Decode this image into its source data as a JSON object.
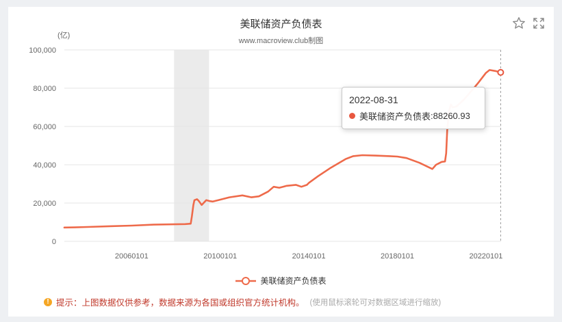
{
  "chart_data": {
    "type": "line",
    "title": "美联储资产负债表",
    "subtitle": "www.macroview.club制图",
    "ylabel": "(亿)",
    "xlabel": "",
    "ylim": [
      0,
      100000
    ],
    "yticks": [
      "0",
      "20,000",
      "40,000",
      "60,000",
      "80,000",
      "100,000"
    ],
    "xticks": [
      {
        "date": "2006-01-01",
        "label": "20060101"
      },
      {
        "date": "2010-01-01",
        "label": "20100101"
      },
      {
        "date": "2014-01-01",
        "label": "20140101"
      },
      {
        "date": "2018-01-01",
        "label": "20180101"
      },
      {
        "date": "2022-01-01",
        "label": "20220101"
      }
    ],
    "xlim": [
      "2002-12-18",
      "2022-09-07"
    ],
    "grid": true,
    "legend": "bottom-center",
    "shaded_region": {
      "start": "2007-12-01",
      "end": "2009-06-30"
    },
    "series": [
      {
        "name": "美联储资产负债表",
        "color": "#ee6a4a",
        "points": [
          [
            "2002-12-18",
            7200
          ],
          [
            "2003-06-01",
            7300
          ],
          [
            "2004-01-01",
            7500
          ],
          [
            "2005-01-01",
            7900
          ],
          [
            "2006-01-01",
            8200
          ],
          [
            "2007-01-01",
            8700
          ],
          [
            "2007-12-01",
            8900
          ],
          [
            "2008-06-01",
            9000
          ],
          [
            "2008-09-01",
            9200
          ],
          [
            "2008-09-20",
            13000
          ],
          [
            "2008-10-15",
            19000
          ],
          [
            "2008-11-01",
            21500
          ],
          [
            "2008-12-15",
            22000
          ],
          [
            "2009-01-15",
            21000
          ],
          [
            "2009-03-01",
            19000
          ],
          [
            "2009-05-15",
            21500
          ],
          [
            "2009-07-15",
            21000
          ],
          [
            "2009-09-01",
            20800
          ],
          [
            "2009-12-01",
            21500
          ],
          [
            "2010-06-01",
            23000
          ],
          [
            "2011-01-01",
            24000
          ],
          [
            "2011-06-01",
            23000
          ],
          [
            "2011-10-01",
            23500
          ],
          [
            "2012-03-01",
            26000
          ],
          [
            "2012-06-01",
            28500
          ],
          [
            "2012-09-01",
            28000
          ],
          [
            "2012-11-01",
            28500
          ],
          [
            "2013-01-01",
            29000
          ],
          [
            "2013-06-01",
            29500
          ],
          [
            "2013-09-01",
            28500
          ],
          [
            "2013-12-01",
            29500
          ],
          [
            "2014-01-01",
            30500
          ],
          [
            "2014-06-01",
            34000
          ],
          [
            "2015-01-01",
            38500
          ],
          [
            "2015-09-01",
            43000
          ],
          [
            "2016-01-01",
            44500
          ],
          [
            "2016-06-01",
            45000
          ],
          [
            "2017-01-01",
            44800
          ],
          [
            "2017-09-01",
            44500
          ],
          [
            "2018-01-01",
            44300
          ],
          [
            "2018-06-01",
            43500
          ],
          [
            "2019-01-01",
            41000
          ],
          [
            "2019-08-01",
            37800
          ],
          [
            "2019-10-01",
            40000
          ],
          [
            "2020-01-01",
            41500
          ],
          [
            "2020-02-25",
            41700
          ],
          [
            "2020-03-15",
            46000
          ],
          [
            "2020-04-01",
            58000
          ],
          [
            "2020-05-01",
            68000
          ],
          [
            "2020-06-01",
            71500
          ],
          [
            "2020-07-01",
            70000
          ],
          [
            "2020-09-01",
            70500
          ],
          [
            "2021-01-01",
            74000
          ],
          [
            "2021-06-01",
            79500
          ],
          [
            "2021-09-01",
            83000
          ],
          [
            "2022-01-01",
            88000
          ],
          [
            "2022-03-01",
            89500
          ],
          [
            "2022-06-01",
            89000
          ],
          [
            "2022-08-31",
            88260.93
          ]
        ]
      }
    ]
  },
  "tooltip": {
    "date": "2022-08-31",
    "series_name": "美联储资产负债表",
    "value": "88260.93"
  },
  "legend": {
    "label": "美联储资产负债表"
  },
  "note": {
    "label": "提示：",
    "text": "上图数据仅供参考，数据来源为各国或组织官方统计机构。",
    "hint": "(使用鼠标滚轮可对数据区域进行缩放)"
  },
  "colors": {
    "line": "#ee6a4a",
    "marker": "#e8573f",
    "shade": "#ebebeb",
    "grid": "#e6e6e6",
    "axis_text": "#666666"
  },
  "icons": {
    "favorite": "star-icon",
    "fullscreen": "expand-icon",
    "note": "warning-icon"
  }
}
